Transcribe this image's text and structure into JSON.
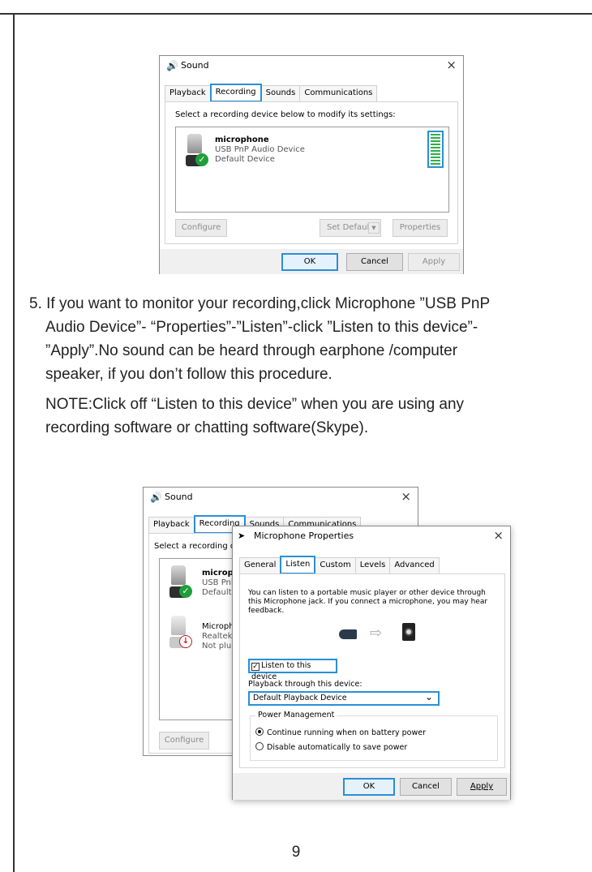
{
  "dialog1": {
    "title": "Sound",
    "close": "×",
    "tabs": [
      "Playback",
      "Recording",
      "Sounds",
      "Communications"
    ],
    "active_tab": 1,
    "instruction": "Select a recording device below to modify its settings:",
    "device": {
      "name": "microphone",
      "line2": "USB PnP Audio Device",
      "line3": "Default Device"
    },
    "buttons": {
      "configure": "Configure",
      "set_default": "Set Default",
      "dropdown": "▼",
      "properties": "Properties",
      "ok": "OK",
      "cancel": "Cancel",
      "apply": "Apply"
    }
  },
  "instructions": {
    "step": "5. If you want to monitor your recording,click Microphone ”USB PnP",
    "step_l2": "Audio Device”- “Properties”-”Listen”-click ”Listen to this device”-",
    "step_l3": "”Apply”.No sound can be heard through earphone /computer",
    "step_l4": "speaker, if you don’t follow this procedure.",
    "note_l1": "NOTE:Click off “Listen to this device” when you are using any",
    "note_l2": "recording software or chatting software(Skype)."
  },
  "dialog2": {
    "title": "Sound",
    "close": "×",
    "tabs": [
      "Playback",
      "Recording",
      "Sounds",
      "Communications"
    ],
    "instruction": "Select a recording de",
    "device1": {
      "name": "micropl",
      "line2": "USB Pnl",
      "line3": "Default"
    },
    "device2": {
      "name": "Microph",
      "line2": "Realtek",
      "line3": "Not plu"
    },
    "configure": "Configure"
  },
  "dialog3": {
    "title": "Microphone Properties",
    "close": "×",
    "tabs": [
      "General",
      "Listen",
      "Custom",
      "Levels",
      "Advanced"
    ],
    "desc_l1": "You can listen to a portable music player or other device through",
    "desc_l2": "this Microphone jack.  If you connect a microphone, you may hear",
    "desc_l3": "feedback.",
    "arrow": "⇨",
    "listen_check": "✓",
    "listen_label": "Listen to this device",
    "playback_label": "Playback through this device:",
    "playback_value": "Default Playback Device",
    "dropdown": "⌄",
    "power_group": "Power Management",
    "radio1": "Continue running when on battery power",
    "radio2": "Disable automatically to save power",
    "buttons": {
      "ok": "OK",
      "cancel": "Cancel",
      "apply": "Apply"
    }
  },
  "page_number": "9"
}
